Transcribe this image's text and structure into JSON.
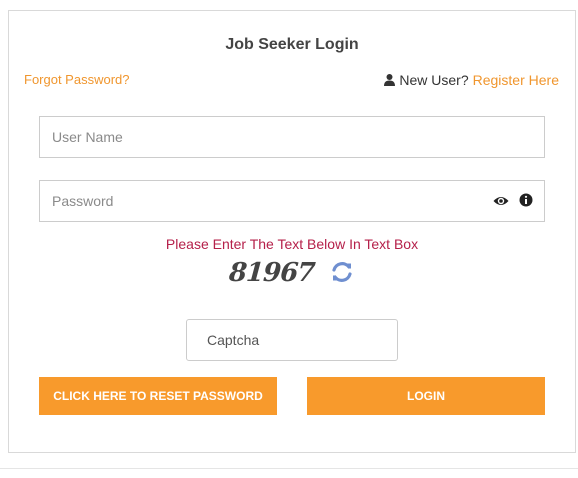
{
  "form": {
    "title": "Job Seeker Login",
    "forgot_password": "Forgot Password?",
    "new_user_text": "New User?",
    "register_link": "Register Here",
    "username_placeholder": "User Name",
    "password_placeholder": "Password",
    "captcha_prompt": "Please Enter The Text Below In Text Box",
    "captcha_code": "81967",
    "captcha_placeholder": "Captcha",
    "reset_button": "CLICK HERE TO RESET PASSWORD",
    "login_button": "LOGIN"
  },
  "icons": [
    "user-icon",
    "eye-icon",
    "info-icon",
    "refresh-icon"
  ],
  "colors": {
    "accent": "#f89a2c",
    "link": "#f0962e",
    "prompt": "#b5204a",
    "refresh": "#6f8fd0"
  }
}
